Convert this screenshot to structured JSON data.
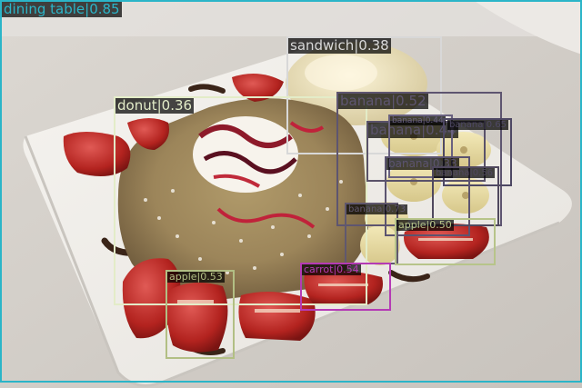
{
  "image": {
    "description_icon": "photo-dessert-plate"
  },
  "detections": [
    {
      "label": "dining table|0.85",
      "color": "#2bb5c8"
    },
    {
      "label": "sandwich|0.38",
      "color": "#d8d8d8"
    },
    {
      "label": "donut|0.36",
      "color": "#e3ecc8"
    },
    {
      "label": "banana|0.52",
      "color": "#5e5570"
    },
    {
      "label": "banana|0.44",
      "color": "#5a526a"
    },
    {
      "label": "banana|0.44",
      "color": "#6a6280"
    },
    {
      "label": "banana|0.65",
      "color": "#4e4864"
    },
    {
      "label": "banana|0.33",
      "color": "#5c5470"
    },
    {
      "label": "banana|0.56",
      "color": "#50485e"
    },
    {
      "label": "banana|0.73",
      "color": "#60586e"
    },
    {
      "label": "apple|0.50",
      "color": "#b7c48a"
    },
    {
      "label": "apple|0.53",
      "color": "#b2bf84"
    },
    {
      "label": "carrot|0.54",
      "color": "#b53bb5"
    }
  ]
}
